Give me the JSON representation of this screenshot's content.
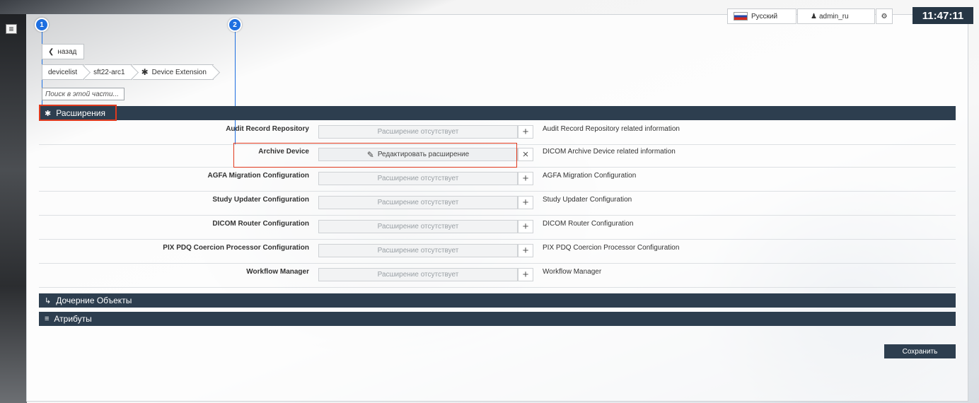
{
  "topbar": {
    "language": "Русский",
    "user": "admin_ru",
    "clock": "11:47:11"
  },
  "callouts": [
    "1",
    "2"
  ],
  "nav": {
    "back_label": "назад",
    "breadcrumb": [
      "devicelist",
      "sft22-arc1",
      "Device Extension"
    ]
  },
  "search": {
    "placeholder": "Поиск в этой части..."
  },
  "sections": {
    "extensions": "Расширения",
    "children": "Дочерние Объекты",
    "attributes": "Атрибуты"
  },
  "rows": [
    {
      "label": "Audit Record Repository",
      "field": "Расширение отсутствует",
      "action": "+",
      "description": "Audit Record Repository related information"
    },
    {
      "label": "Archive Device",
      "field": "Редактировать расширение",
      "action": "×",
      "description": "DICOM Archive Device related information"
    },
    {
      "label": "AGFA Migration Configuration",
      "field": "Расширение отсутствует",
      "action": "+",
      "description": "AGFA Migration Configuration"
    },
    {
      "label": "Study Updater Configuration",
      "field": "Расширение отсутствует",
      "action": "+",
      "description": "Study Updater Configuration"
    },
    {
      "label": "DICOM Router Configuration",
      "field": "Расширение отсутствует",
      "action": "+",
      "description": "DICOM Router Configuration"
    },
    {
      "label": "PIX PDQ Coercion Processor Configuration",
      "field": "Расширение отсутствует",
      "action": "+",
      "description": "PIX PDQ Coercion Processor Configuration"
    },
    {
      "label": "Workflow Manager",
      "field": "Расширение отсутствует",
      "action": "+",
      "description": "Workflow Manager"
    }
  ],
  "save_label": "Сохранить",
  "colors": {
    "header": "#2d3e4f",
    "callout": "#1e6fe0",
    "highlight": "#e03a1e"
  }
}
